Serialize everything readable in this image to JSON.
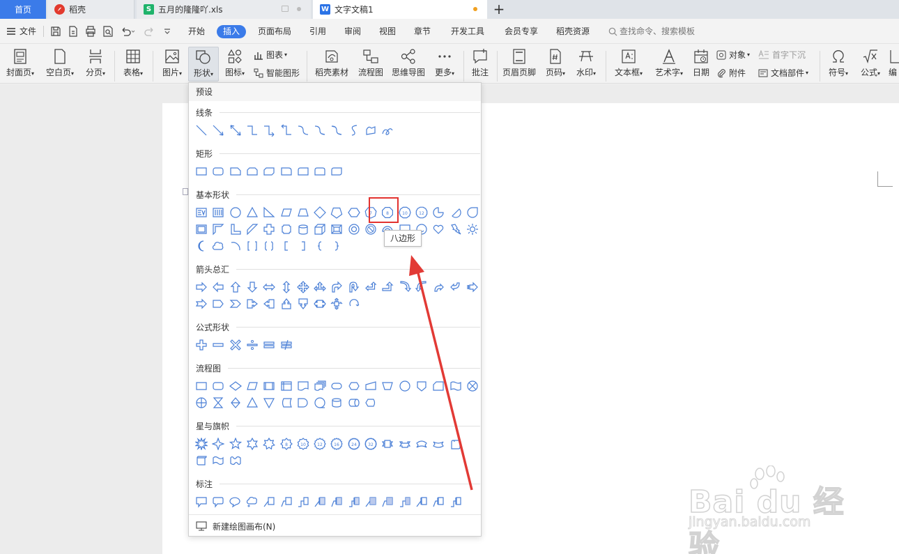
{
  "tabs": {
    "home": "首页",
    "daoke": "稻壳",
    "xls": "五月的隆隆吖.xls",
    "doc": "文字文稿1",
    "add": "+"
  },
  "menubar": {
    "file": "文件",
    "tabs": [
      "开始",
      "插入",
      "页面布局",
      "引用",
      "审阅",
      "视图",
      "章节",
      "开发工具",
      "会员专享",
      "稻壳资源"
    ],
    "active_tab": "插入",
    "search_placeholder": "查找命令、搜索模板"
  },
  "ribbon": {
    "cover": "封面页",
    "blank": "空白页",
    "break": "分页",
    "table": "表格",
    "picture": "图片",
    "shape": "形状",
    "icon": "图标",
    "chart": "图表",
    "smart_shape": "智能图形",
    "daoke_material": "稻壳素材",
    "flowchart": "流程图",
    "mindmap": "思维导图",
    "more": "更多",
    "comment": "批注",
    "header_footer": "页眉页脚",
    "page_number": "页码",
    "watermark": "水印",
    "textbox": "文本框",
    "wordart": "艺术字",
    "date": "日期",
    "object": "对象",
    "dropcap": "首字下沉",
    "attachment": "附件",
    "docparts": "文档部件",
    "symbol": "符号",
    "formula": "公式",
    "edit": "编"
  },
  "panel": {
    "header": "预设",
    "categories": {
      "lines": "线条",
      "rect": "矩形",
      "basic": "基本形状",
      "arrows": "箭头总汇",
      "equation": "公式形状",
      "flow": "流程图",
      "stars": "星与旗帜",
      "callouts": "标注"
    },
    "footer": "新建绘图画布(N)",
    "tooltip": "八边形",
    "shape_labels": {
      "heptagon": "7",
      "octagon": "8",
      "decagon": "10",
      "dodecagon": "12",
      "star8": "8",
      "star10": "10",
      "star12": "12",
      "star16": "16",
      "star24": "24",
      "star32": "32"
    }
  },
  "watermark": {
    "main": "Bai du 经验",
    "sub": "jingyan.baidu.com"
  },
  "colors": {
    "accent": "#3b7be9",
    "highlight": "#e2322f",
    "shape_stroke": "#4a7fd6",
    "xls_green": "#1fb36b",
    "doc_blue": "#2b73e6",
    "daoke_red": "#e23a2e"
  }
}
